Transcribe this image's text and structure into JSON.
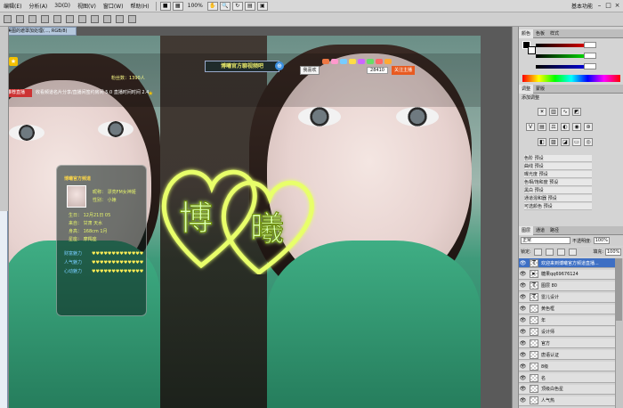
{
  "menubar": {
    "items": [
      "编辑(E)",
      "图像(I)",
      "图层(L)",
      "选择(S)",
      "滤镜(T)",
      "分析(A)",
      "3D(D)",
      "视图(V)",
      "窗口(W)",
      "帮助(H)"
    ],
    "zoom": "100%",
    "workspace": "基本功能",
    "win_buttons": [
      "–",
      "□",
      "×"
    ]
  },
  "document_tab": "唯美图的遮罩加处理(..., RGB/8)",
  "stream": {
    "title_badge": "博曦官方聊视频吧",
    "host_button": "我喜欢",
    "room_id": "28410",
    "follow_button": "关注主播",
    "member_line": "粉丝数：1390人",
    "ticker": "收看频道名片分享/直播间签约房间 5.0 直播时间时间 2.4",
    "tag_left": "推荐直播",
    "info_title": "博曦官方频道",
    "info_rows": [
      "昵称：  漂亮FM女神姬",
      "性别：  小婊",
      "生日：  12月21日 05",
      "来自：  甘肃  天水",
      "身高：  168cm  1月",
      "星座：  摩羯座"
    ],
    "hearts_labels": [
      "财富魅力",
      "人气魅力",
      "心动魅力"
    ],
    "hearts": "♥♥♥♥♥♥♥♥♥♥♥♥♥",
    "logo_text_1": "博",
    "logo_text_2": "曦"
  },
  "panels": {
    "color_tabs": [
      "颜色",
      "色板",
      "样式"
    ],
    "adjust_tabs": [
      "调整",
      "蒙版"
    ],
    "adjust_title": "添加调整",
    "presets": [
      "色阶 预设",
      "曲线 预设",
      "曝光度 预设",
      "色相/饱和度 预设",
      "黑白 预设",
      "通道混和器 预设",
      "可选颜色 预设"
    ],
    "layers_tabs": [
      "图层",
      "通道",
      "路径"
    ],
    "blend_mode": "正常",
    "opacity_label": "不透明度:",
    "opacity": "100%",
    "lock_label": "锁定:",
    "fill_label": "填充:",
    "fill": "100%",
    "layers": [
      {
        "name": "欢迎来到博曦官方频道直播...",
        "type": "T",
        "selected": true
      },
      {
        "name": "糖果qq69676124",
        "type": "folder",
        "selected": false
      },
      {
        "name": "图层 80",
        "type": "T",
        "selected": false
      },
      {
        "name": "雷儿设计",
        "type": "T",
        "selected": false
      },
      {
        "name": "黄色框",
        "type": "px",
        "selected": false
      },
      {
        "name": "年",
        "type": "px",
        "selected": false
      },
      {
        "name": "设计师",
        "type": "px",
        "selected": false
      },
      {
        "name": "官方",
        "type": "px",
        "selected": false
      },
      {
        "name": "唐语认证",
        "type": "px",
        "selected": false
      },
      {
        "name": "8级",
        "type": "px",
        "selected": false
      },
      {
        "name": "名",
        "type": "px",
        "selected": false
      },
      {
        "name": "顶级白色星",
        "type": "px",
        "selected": false
      },
      {
        "name": "人气热",
        "type": "px",
        "selected": false
      }
    ]
  }
}
